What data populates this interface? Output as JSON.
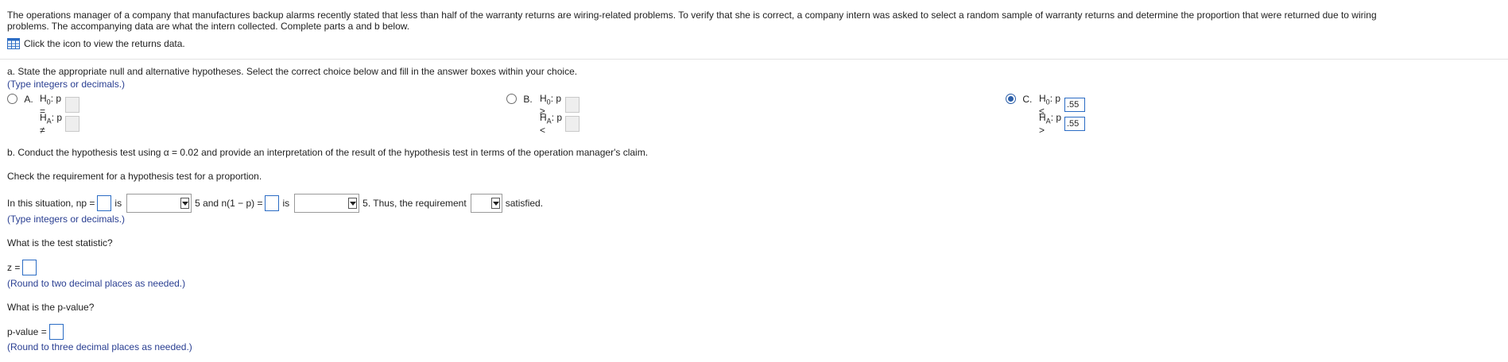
{
  "question": {
    "intro_line1": "The operations manager of a company that manufactures backup alarms recently stated that less than half of the warranty returns are wiring-related problems. To verify that she is correct, a company intern was asked to select a random sample of warranty returns and determine the proportion that were returned due to wiring",
    "intro_line2": "problems. The accompanying data are what the intern collected. Complete parts a and b below.",
    "data_link": "Click the icon to view the returns data."
  },
  "part_a": {
    "prompt": "a. State the appropriate null and alternative hypotheses. Select the correct choice below and fill in the answer boxes within your choice.",
    "hint": "(Type integers or decimals.)",
    "options": [
      {
        "letter": "A.",
        "h0_label": "H",
        "h0_sub": "0",
        "h0_rel": ": p =",
        "ha_label": "H",
        "ha_sub": "A",
        "ha_rel": ": p ≠",
        "h0_value": "",
        "ha_value": ""
      },
      {
        "letter": "B.",
        "h0_label": "H",
        "h0_sub": "0",
        "h0_rel": ": p ≥",
        "ha_label": "H",
        "ha_sub": "A",
        "ha_rel": ": p <",
        "h0_value": "",
        "ha_value": ""
      },
      {
        "letter": "C.",
        "h0_label": "H",
        "h0_sub": "0",
        "h0_rel": ": p ≤",
        "ha_label": "H",
        "ha_sub": "A",
        "ha_rel": ": p >",
        "h0_value": ".55",
        "ha_value": ".55"
      }
    ],
    "selected": "C."
  },
  "part_b": {
    "prompt": "b. Conduct the hypothesis test using α = 0.02 and provide an interpretation of the result of the hypothesis test in terms of the operation manager's claim.",
    "check": "Check the requirement for a hypothesis test for a proportion.",
    "situation_pre": "In this situation, np =",
    "is1": "is",
    "five_and": "5 and n(1 − p) =",
    "is2": "is",
    "thus": "5. Thus, the requirement",
    "satisfied": "satisfied.",
    "hint1": "(Type integers or decimals.)",
    "test_stat_q": "What is the test statistic?",
    "z_label": "z =",
    "hint2": "(Round to two decimal places as needed.)",
    "pvalue_q": "What is the p-value?",
    "pvalue_label": "p-value =",
    "hint3": "(Round to three decimal places as needed.)"
  },
  "colors": {
    "accent": "#2b6cc4",
    "hint": "#2a3f92",
    "selected_radio": "#2b5ea8"
  },
  "icons": {
    "data_table": "table-grid-icon"
  }
}
